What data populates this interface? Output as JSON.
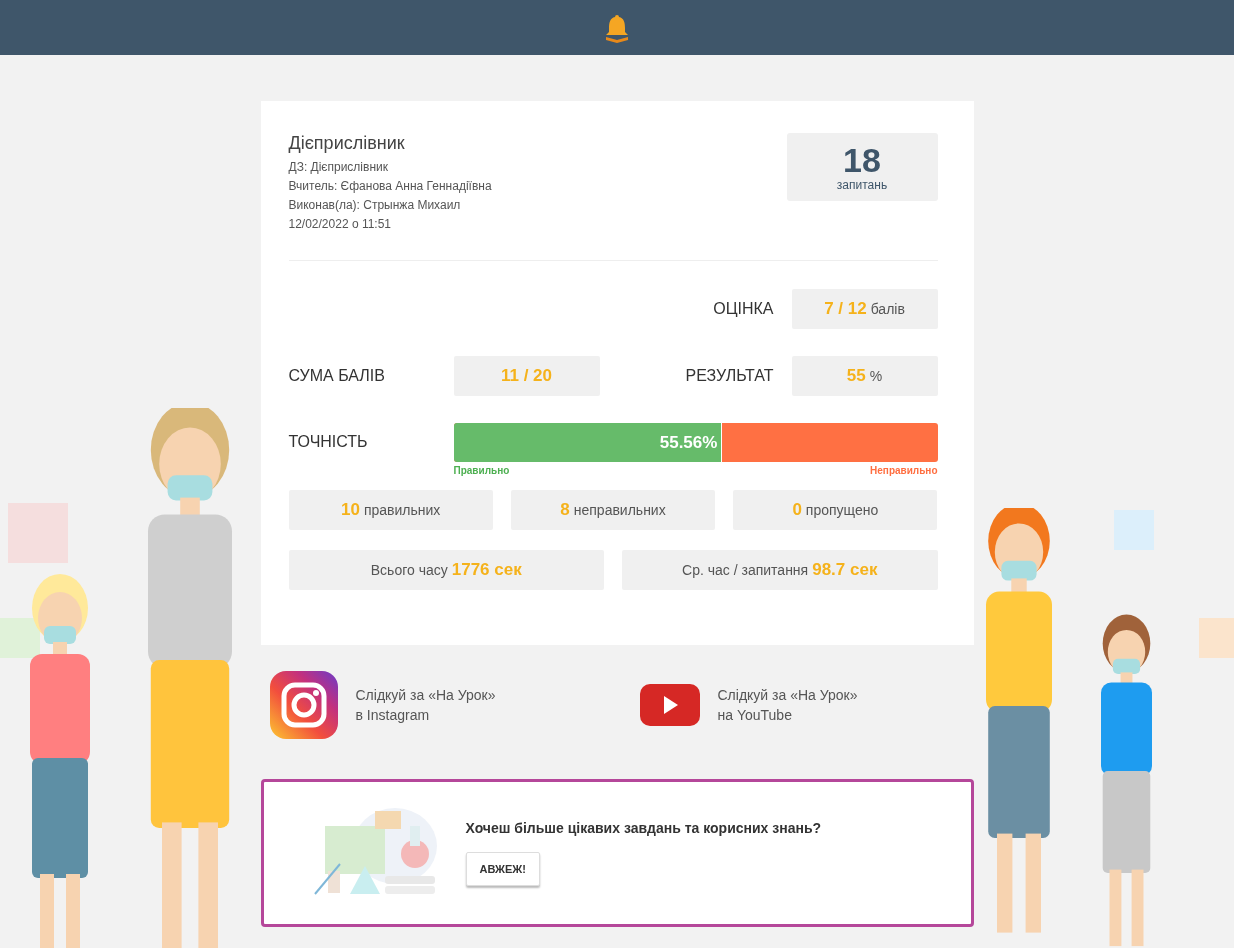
{
  "result": {
    "title": "Дієприслівник",
    "lines": [
      "ДЗ: Дієприслівник",
      "Вчитель: Єфанова Анна Геннадіївна",
      "Виконав(ла): Стрынжа Михаил",
      "12/02/2022 о 11:51"
    ],
    "questions": {
      "value": "18",
      "label": "запитань"
    },
    "grade": {
      "label": "ОЦІНКА",
      "value": "7 / 12",
      "unit": "балів"
    },
    "score": {
      "label": "СУМА БАЛІВ",
      "value": "11 / 20"
    },
    "percent": {
      "label": "РЕЗУЛЬТАТ",
      "value": "55",
      "unit": "%"
    },
    "accuracy": {
      "label": "ТОЧНІСТЬ",
      "reading": "55.56%",
      "level": 0.5556,
      "correct_label": "Правильно",
      "wrong_label": "Неправильно"
    },
    "counts": [
      {
        "value": "10",
        "text": "правильних"
      },
      {
        "value": "8",
        "text": "неправильних"
      },
      {
        "value": "0",
        "text": "пропущено"
      }
    ],
    "times": [
      {
        "text": "Всього часу",
        "value": "1776 сек"
      },
      {
        "text": "Ср. час / запитання",
        "value": "98.7 сек"
      }
    ]
  },
  "social": [
    {
      "kind": "instagram",
      "lines": [
        "Слідкуй за «На Урок»",
        "в Instagram"
      ]
    },
    {
      "kind": "youtube",
      "lines": [
        "Слідкуй за «На Урок»",
        "на YouTube"
      ]
    }
  ],
  "promo": {
    "text": "Хочеш більше цікавих завдань та корисних знань?",
    "button": "АВЖЕЖ!"
  }
}
